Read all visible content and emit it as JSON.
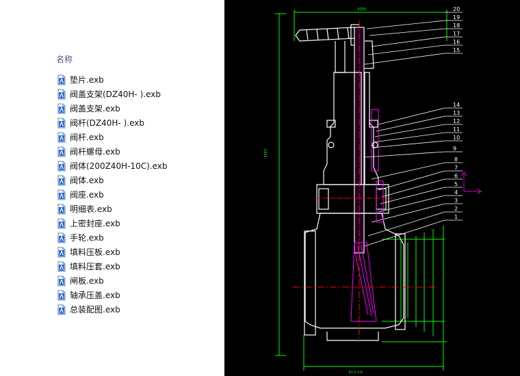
{
  "column_header": "名称",
  "files": [
    {
      "name": "垫片.exb",
      "icon": "exb-file-icon"
    },
    {
      "name": "阀盖支架(DZ40H- ).exb",
      "icon": "exb-file-icon"
    },
    {
      "name": "阀盖支架.exb",
      "icon": "exb-file-icon"
    },
    {
      "name": "阀杆(DZ40H- ).exb",
      "icon": "exb-file-icon"
    },
    {
      "name": "阀杆.exb",
      "icon": "exb-file-icon"
    },
    {
      "name": "阀杆螺母.exb",
      "icon": "exb-file-icon"
    },
    {
      "name": "阀体(200Z40H-10C).exb",
      "icon": "exb-file-icon"
    },
    {
      "name": "阀体.exb",
      "icon": "exb-file-icon"
    },
    {
      "name": "阀座.exb",
      "icon": "exb-file-icon"
    },
    {
      "name": "明细表.exb",
      "icon": "exb-file-icon"
    },
    {
      "name": "上密封座.exb",
      "icon": "exb-file-icon"
    },
    {
      "name": "手轮.exb",
      "icon": "exb-file-icon"
    },
    {
      "name": "填料压板.exb",
      "icon": "exb-file-icon"
    },
    {
      "name": "填料压套.exb",
      "icon": "exb-file-icon"
    },
    {
      "name": "闸板.exb",
      "icon": "exb-file-icon"
    },
    {
      "name": "轴承压盖.exb",
      "icon": "exb-file-icon"
    },
    {
      "name": "总装配图.exb",
      "icon": "exb-file-icon"
    }
  ],
  "drawing": {
    "part_numbers_upper": [
      "20",
      "19",
      "18",
      "17",
      "16",
      "15"
    ],
    "part_numbers_middle": [
      "14",
      "13",
      "12",
      "11",
      "10",
      "9"
    ],
    "part_numbers_lower": [
      "8",
      "7",
      "6",
      "5",
      "4",
      "3",
      "2",
      "1"
    ],
    "colors": {
      "background": "#000000",
      "outline": "#ffffff",
      "dimension": "#00ff00",
      "centerline": "#ff0000",
      "hatch": "#ff00ff",
      "axis": "#cc00cc"
    }
  }
}
